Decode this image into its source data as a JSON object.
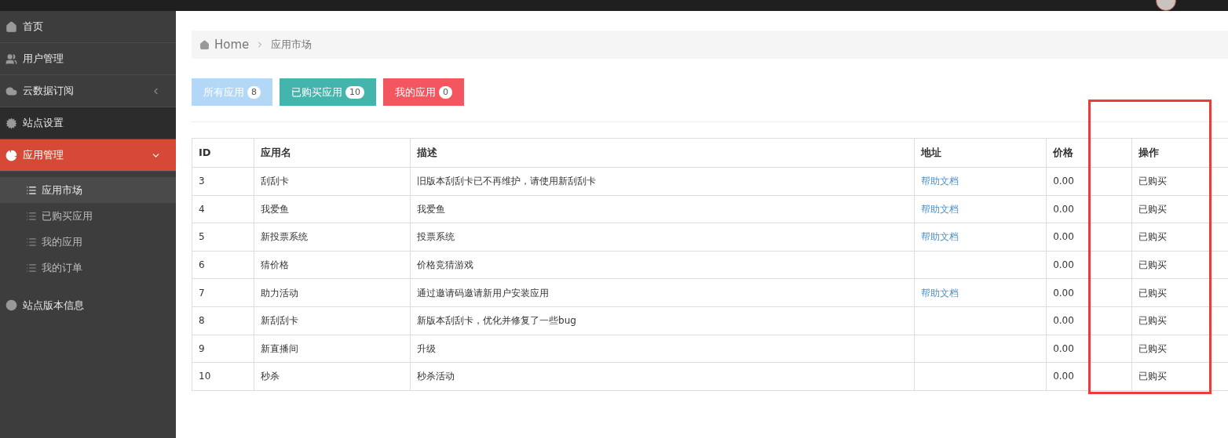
{
  "sidebar": {
    "items": [
      {
        "label": "首页",
        "kind": "link",
        "selected": false,
        "highlighted": false
      },
      {
        "label": "用户管理",
        "kind": "link",
        "selected": false,
        "highlighted": false
      },
      {
        "label": "云数据订阅",
        "kind": "group",
        "expanded": false,
        "selected": false,
        "highlighted": false
      },
      {
        "label": "站点设置",
        "kind": "link",
        "selected": false,
        "highlighted": true
      },
      {
        "label": "应用管理",
        "kind": "group",
        "expanded": true,
        "selected": true,
        "highlighted": false,
        "children": [
          {
            "label": "应用市场",
            "selected": true
          },
          {
            "label": "已购买应用",
            "selected": false
          },
          {
            "label": "我的应用",
            "selected": false
          },
          {
            "label": "我的订单",
            "selected": false
          }
        ]
      },
      {
        "label": "站点版本信息",
        "kind": "link",
        "selected": false,
        "highlighted": false
      }
    ]
  },
  "breadcrumb": [
    "Home",
    "应用市场"
  ],
  "filters": [
    {
      "label": "所有应用",
      "count": "8",
      "color": "#b3d8f7"
    },
    {
      "label": "已购买应用",
      "count": "10",
      "color": "#44b5ad"
    },
    {
      "label": "我的应用",
      "count": "0",
      "color": "#f4565f"
    }
  ],
  "table": {
    "columns": [
      "ID",
      "应用名",
      "描述",
      "地址",
      "价格",
      "操作"
    ],
    "rows": [
      {
        "id": "3",
        "name": "刮刮卡",
        "description": "旧版本刮刮卡已不再维护，请使用新刮刮卡",
        "address": "帮助文档",
        "price": "0.00",
        "action": "已购买"
      },
      {
        "id": "4",
        "name": "我爱鱼",
        "description": "我爱鱼",
        "address": "帮助文档",
        "price": "0.00",
        "action": "已购买"
      },
      {
        "id": "5",
        "name": "新投票系统",
        "description": "投票系统",
        "address": "帮助文档",
        "price": "0.00",
        "action": "已购买"
      },
      {
        "id": "6",
        "name": "猜价格",
        "description": "价格竞猜游戏",
        "price": "0.00",
        "action": "已购买"
      },
      {
        "id": "7",
        "name": "助力活动",
        "description": "通过邀请码邀请新用户安装应用",
        "address": "帮助文档",
        "price": "0.00",
        "action": "已购买"
      },
      {
        "id": "8",
        "name": "新刮刮卡",
        "description": "新版本刮刮卡，优化并修复了一些bug",
        "price": "0.00",
        "action": "已购买"
      },
      {
        "id": "9",
        "name": "新直播间",
        "description": "升级",
        "price": "0.00",
        "action": "已购买"
      },
      {
        "id": "10",
        "name": "秒杀",
        "description": "秒杀活动",
        "price": "0.00",
        "action": "已购买"
      }
    ]
  }
}
